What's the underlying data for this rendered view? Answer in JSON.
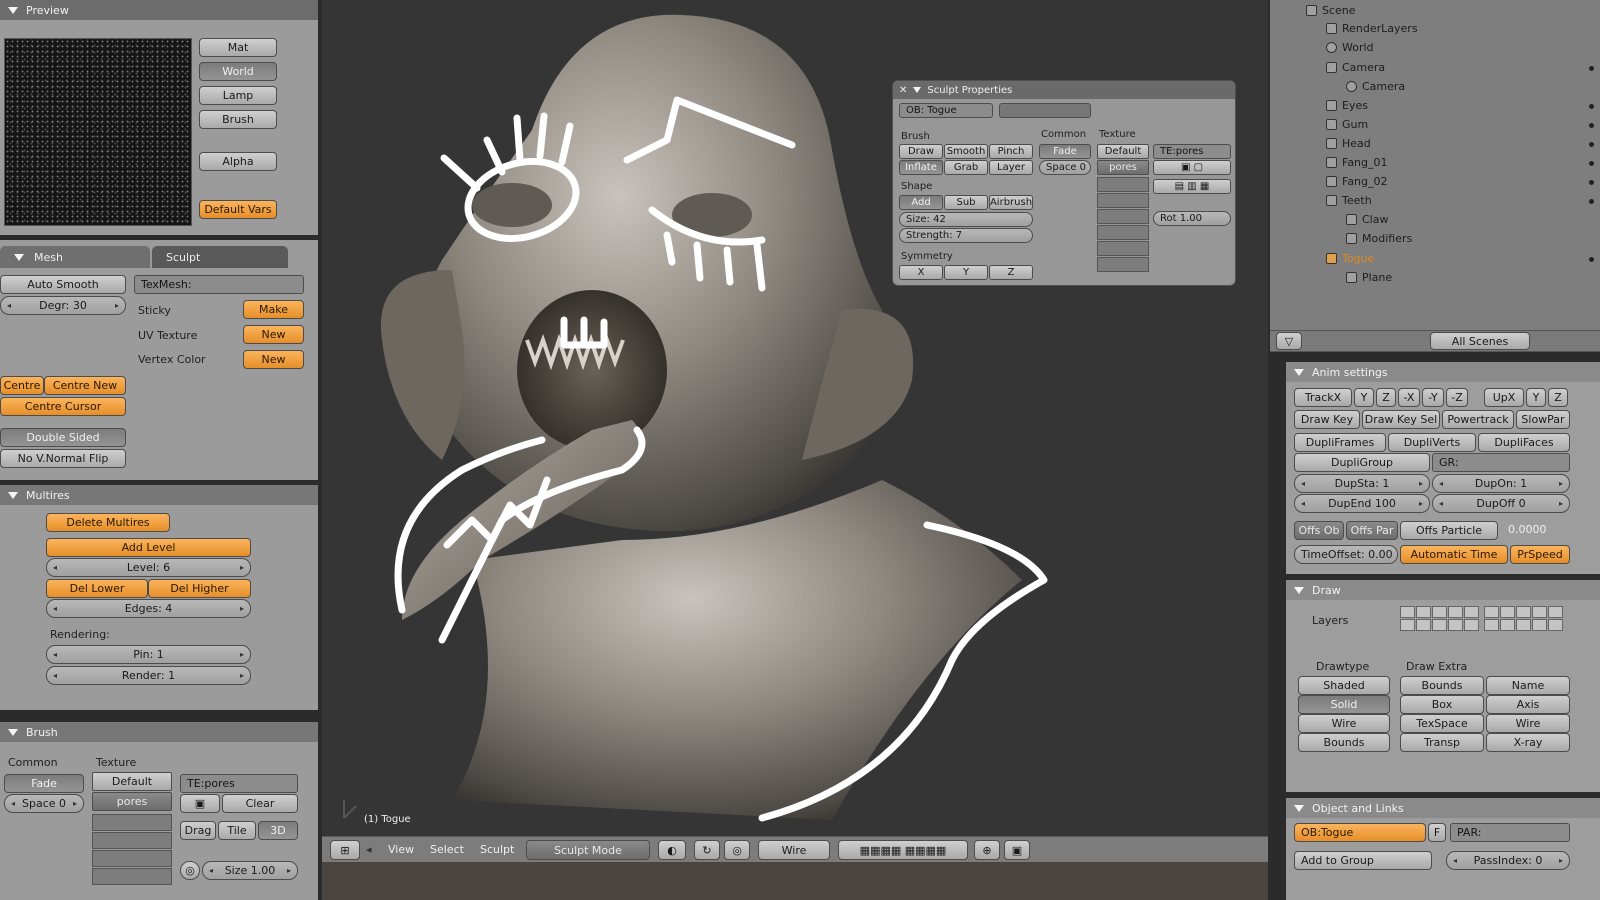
{
  "preview": {
    "title": "Preview",
    "buttons": [
      "Mat",
      "World",
      "Lamp",
      "Brush"
    ],
    "alpha": "Alpha",
    "default_vars": "Default Vars"
  },
  "mesh": {
    "tabs": [
      "Mesh",
      "Sculpt"
    ],
    "auto_smooth": "Auto Smooth",
    "degr": "Degr: 30",
    "texmesh": "TexMesh:",
    "sticky": "Sticky",
    "uv_texture": "UV Texture",
    "vertex_color": "Vertex Color",
    "make": "Make",
    "new1": "New",
    "new2": "New",
    "centre": "Centre",
    "centre_new": "Centre New",
    "centre_cursor": "Centre Cursor",
    "double_sided": "Double Sided",
    "no_v_normal_flip": "No V.Normal Flip"
  },
  "multires": {
    "title": "Multires",
    "delete": "Delete Multires",
    "add_level": "Add Level",
    "level": "Level: 6",
    "del_lower": "Del Lower",
    "del_higher": "Del Higher",
    "edges": "Edges: 4",
    "rendering": "Rendering:",
    "pin": "Pin: 1",
    "render": "Render: 1"
  },
  "brush": {
    "title": "Brush",
    "common": "Common",
    "texture": "Texture",
    "fade": "Fade",
    "space": "Space 0",
    "default": "Default",
    "pores": "pores",
    "tex_name": "TE:pores",
    "clear": "Clear",
    "drag": "Drag",
    "tile": "Tile",
    "three_d": "3D",
    "size": "Size 1.00"
  },
  "viewport": {
    "object_label": "(1) Togue",
    "menu": [
      "View",
      "Select",
      "Sculpt"
    ],
    "mode": "Sculpt Mode",
    "shading": "Wire"
  },
  "sculpt_properties": {
    "title": "Sculpt Properties",
    "ob_field": "OB: Togue",
    "brush_label": "Brush",
    "common_label": "Common",
    "texture_label": "Texture",
    "brush_buttons": [
      "Draw",
      "Smooth",
      "Pinch",
      "Inflate",
      "Grab",
      "Layer"
    ],
    "fade": "Fade",
    "space": "Space 0",
    "default": "Default",
    "pores": "pores",
    "tex_name": "TE:pores",
    "shape_label": "Shape",
    "add": "Add",
    "sub": "Sub",
    "airbrush": "Airbrush",
    "size": "Size: 42",
    "strength": "Strength: 7",
    "symmetry_label": "Symmetry",
    "axes": [
      "X",
      "Y",
      "Z"
    ],
    "rot": "Rot 1.00"
  },
  "outliner": {
    "items": [
      "Scene",
      "RenderLayers",
      "World",
      "Camera",
      "Camera",
      "Eyes",
      "Gum",
      "Head",
      "Fang_01",
      "Fang_02",
      "Teeth",
      "Claw",
      "Modifiers",
      "Togue",
      "Plane"
    ],
    "scenes": "All Scenes"
  },
  "anim": {
    "title": "Anim settings",
    "trackx": "TrackX",
    "axes": [
      "Y",
      "Z",
      "-X",
      "-Y",
      "-Z"
    ],
    "upx": "UpX",
    "upy": "Y",
    "upz": "Z",
    "draw_key": "Draw Key",
    "draw_key_sel": "Draw Key Sel",
    "powertrack": "Powertrack",
    "slowpar": "SlowPar",
    "dupliframes": "DupliFrames",
    "dupliverts": "DupliVerts",
    "duplifaces": "DupliFaces",
    "dupligroup": "DupliGroup",
    "gr": "GR:",
    "dupsta": "DupSta: 1",
    "dupon": "DupOn: 1",
    "dupend": "DupEnd 100",
    "dupoff": "DupOff 0",
    "offs_ob": "Offs Ob",
    "offs_par": "Offs Par",
    "offs_particle": "Offs Particle",
    "time_value": "0.0000",
    "timeoffset": "TimeOffset: 0.00",
    "automatic_time": "Automatic Time",
    "prspeed": "PrSpeed"
  },
  "draw": {
    "title": "Draw",
    "layers": "Layers",
    "drawtype": "Drawtype",
    "draw_extra": "Draw Extra",
    "types": [
      "Shaded",
      "Solid",
      "Wire",
      "Bounds"
    ],
    "extra_left": [
      "Bounds",
      "Box",
      "TexSpace",
      "Transp"
    ],
    "extra_right": [
      "Name",
      "Axis",
      "Wire",
      "X-ray"
    ]
  },
  "object": {
    "title": "Object and Links",
    "ob": "OB:Togue",
    "f": "F",
    "par": "PAR:",
    "add_to_group": "Add to Group",
    "passindex": "PassIndex: 0"
  },
  "colors": {
    "panel": "#9b9b9b",
    "orange": "#f0a040",
    "viewport": "#353535"
  }
}
